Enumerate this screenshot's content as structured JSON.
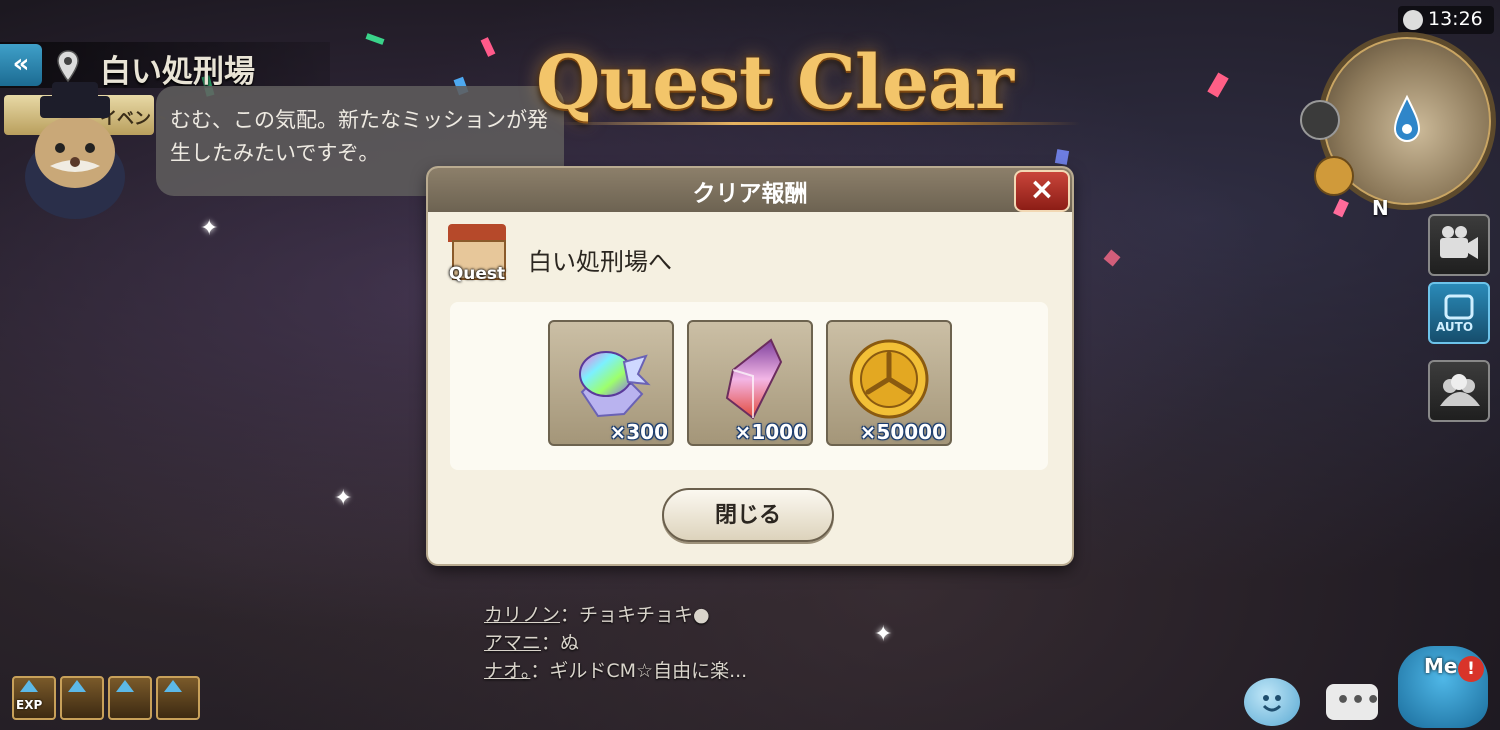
{
  "header": {
    "location_name": "白い処刑場",
    "event_tag": "イベント",
    "clock": "13:26"
  },
  "banner": {
    "title": "Quest Clear"
  },
  "npc_message": {
    "text": "むむ、この気配。新たなミッションが発生したみたいですぞ。"
  },
  "minimap": {
    "north_label": "N"
  },
  "side_buttons": {
    "auto_label": "AUTO"
  },
  "dialog": {
    "title": "クリア報酬",
    "quest_icon_label": "Quest",
    "quest_name": "白い処刑場へ",
    "rewards": [
      {
        "item": "rainbow-crystal-ore",
        "quantity": "×300"
      },
      {
        "item": "pink-crystal-shard",
        "quantity": "×1000"
      },
      {
        "item": "gold-coin",
        "quantity": "×50000"
      }
    ],
    "close_button": "閉じる"
  },
  "chat": [
    {
      "name": "カリノン",
      "message": "：チョキチョキ●"
    },
    {
      "name": "アマニ",
      "message": "：ぬ"
    },
    {
      "name": "ナオ。",
      "message": "：ギルドCM☆自由に楽..."
    }
  ],
  "buffs": {
    "exp_label": "EXP"
  },
  "bottom_right": {
    "me_label": "Me",
    "me_badge": "!",
    "chat_dots": "•••"
  },
  "colors": {
    "accent_gold": "#f3c56a",
    "dialog_bg": "#f5f0e1",
    "close_red": "#c9453a",
    "qty_outline": "#1b3c6e"
  }
}
